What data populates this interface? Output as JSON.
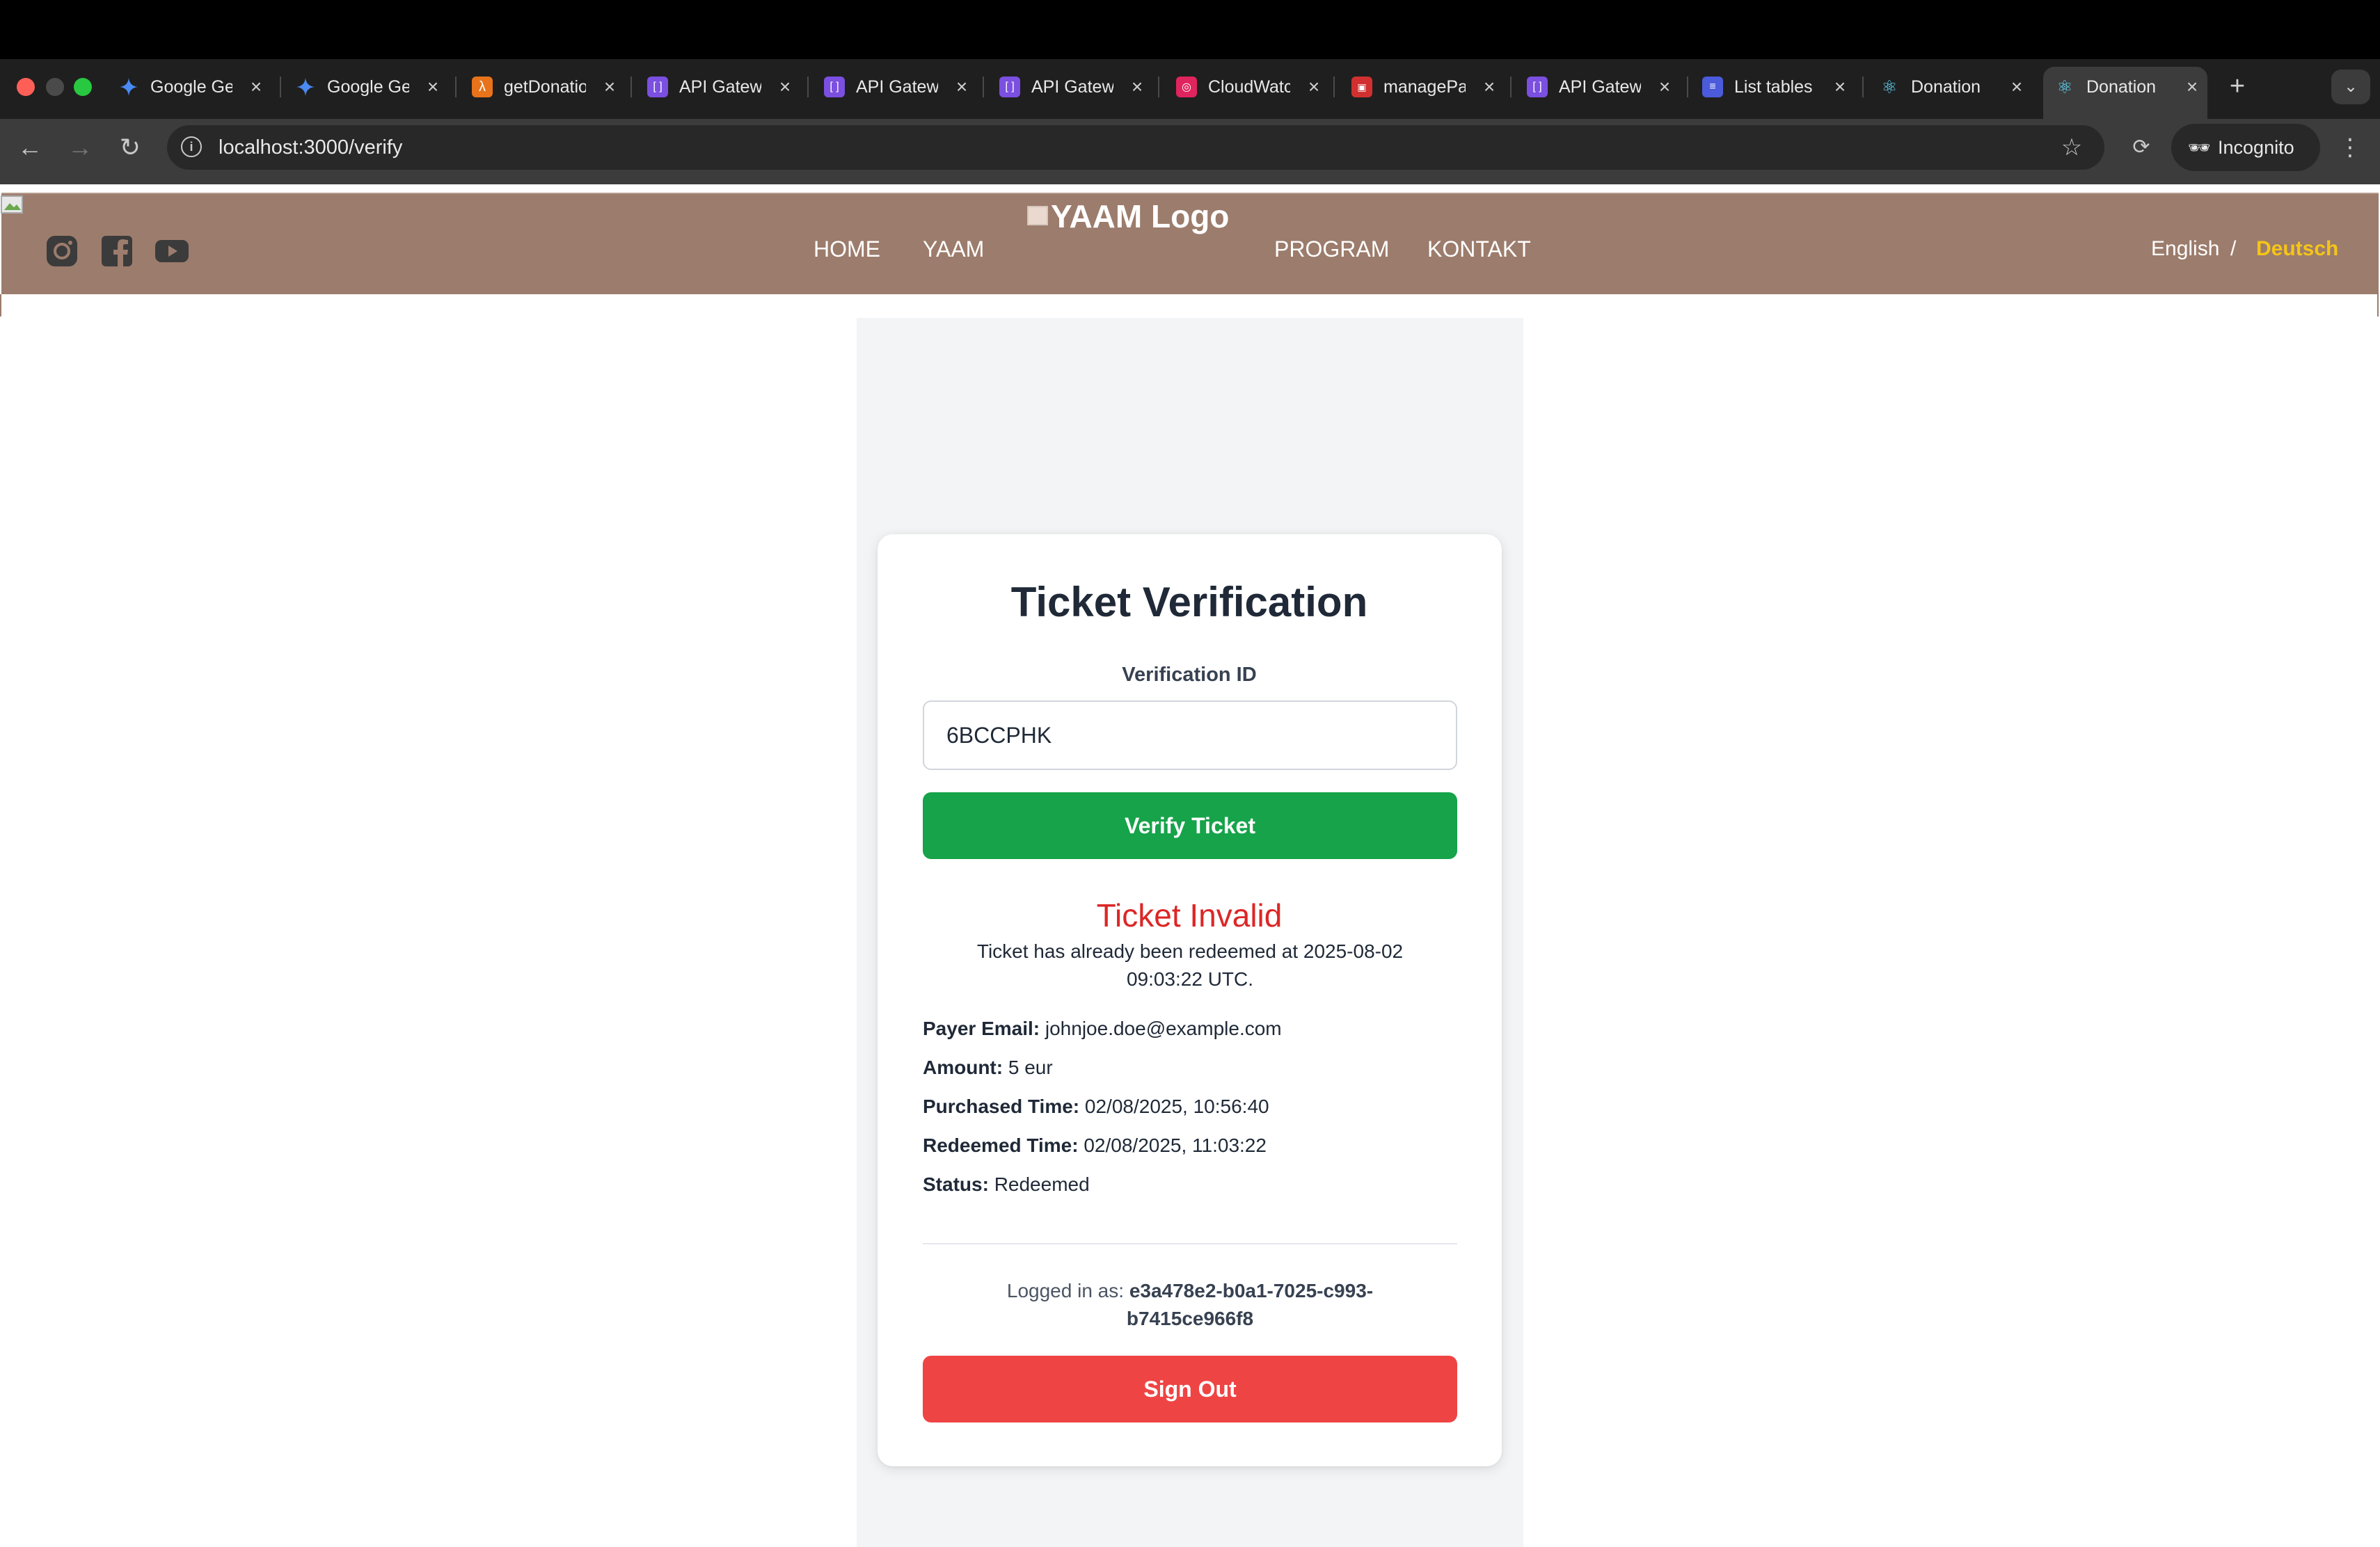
{
  "browser": {
    "tabs": [
      {
        "label": "Google Gemini",
        "icon": "gemini-icon"
      },
      {
        "label": "Google Gemini",
        "icon": "gemini-icon"
      },
      {
        "label": "getDonations",
        "icon": "aws-lambda-icon"
      },
      {
        "label": "API Gateway",
        "icon": "api-gateway-icon"
      },
      {
        "label": "API Gateway",
        "icon": "api-gateway-icon"
      },
      {
        "label": "API Gateway",
        "icon": "api-gateway-icon"
      },
      {
        "label": "CloudWatch",
        "icon": "cloudwatch-icon"
      },
      {
        "label": "managePayments",
        "icon": "aws-icon"
      },
      {
        "label": "API Gateway",
        "icon": "api-gateway-icon"
      },
      {
        "label": "List tables",
        "icon": "dynamodb-icon"
      },
      {
        "label": "Donation",
        "icon": "react-icon"
      },
      {
        "label": "Donation",
        "icon": "react-icon",
        "active": true
      }
    ],
    "url": "localhost:3000/verify",
    "incognito_label": "Incognito"
  },
  "site": {
    "logo_alt": "YAAM Logo",
    "nav": {
      "home": "HOME",
      "yaam": "YAAM",
      "program": "PROGRAM",
      "kontakt": "KONTAKT"
    },
    "lang": {
      "english": "English",
      "sep": "/",
      "deutsch": "Deutsch",
      "active_color": "#f5c518"
    },
    "header_color": "#9c7c6c"
  },
  "card": {
    "title": "Ticket Verification",
    "verification_label": "Verification ID",
    "verification_value": "6BCCPHK",
    "verify_button": "Verify Ticket",
    "result_title": "Ticket Invalid",
    "result_message": "Ticket has already been redeemed at 2025-08-02 09:03:22 UTC.",
    "details": {
      "payer_email_label": "Payer Email:",
      "payer_email": "johnjoe.doe@example.com",
      "amount_label": "Amount:",
      "amount": "5 eur",
      "purchased_label": "Purchased Time:",
      "purchased": "02/08/2025, 10:56:40",
      "redeemed_label": "Redeemed Time:",
      "redeemed": "02/08/2025, 11:03:22",
      "status_label": "Status:",
      "status": "Redeemed"
    },
    "logged_in_label": "Logged in as:",
    "logged_in_user": "e3a478e2-b0a1-7025-c993-b7415ce966f8",
    "signout_button": "Sign Out",
    "verify_color": "#16a34a",
    "signout_color": "#ef4444",
    "invalid_color": "#dc2626"
  }
}
